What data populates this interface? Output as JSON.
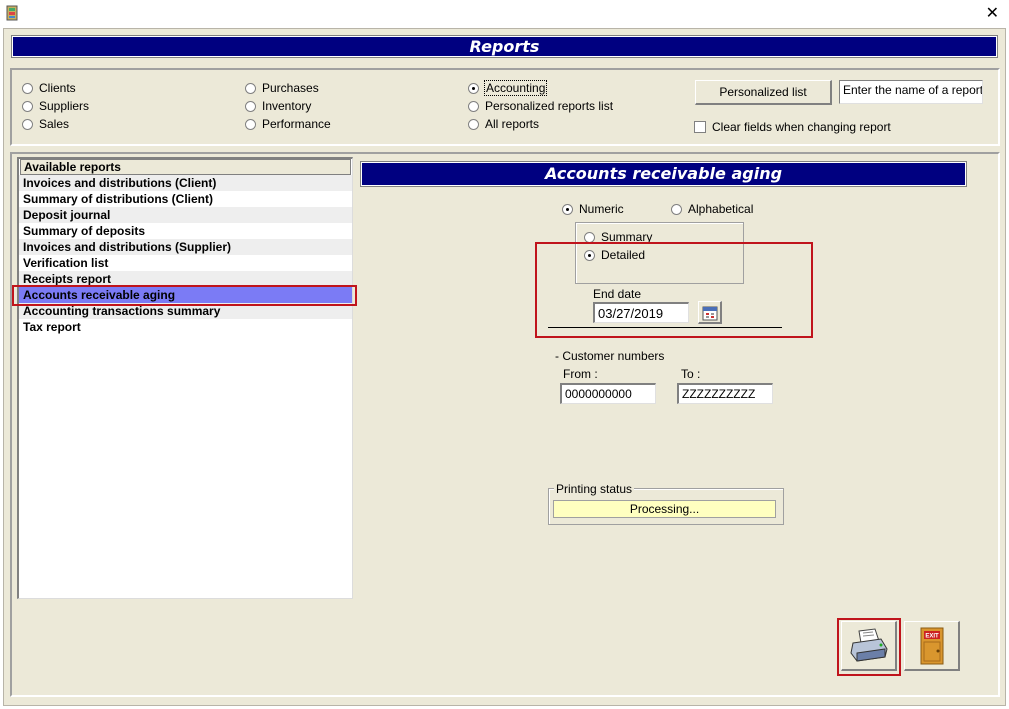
{
  "window": {
    "close_glyph": "✕"
  },
  "header": {
    "title": "Reports"
  },
  "categories": {
    "clients": "Clients",
    "suppliers": "Suppliers",
    "sales": "Sales",
    "purchases": "Purchases",
    "inventory": "Inventory",
    "performance": "Performance",
    "accounting": "Accounting",
    "personalized_reports_list": "Personalized reports list",
    "all_reports": "All reports",
    "selected": "accounting"
  },
  "top_controls": {
    "personalized_list_button": "Personalized list",
    "report_name_value": "Enter the name of a report",
    "clear_fields_label": "Clear fields when changing report",
    "clear_fields_checked": false
  },
  "reports_list": {
    "header": "Available reports",
    "items": [
      "Invoices and distributions (Client)",
      "Summary of distributions (Client)",
      "Deposit journal",
      "Summary of deposits",
      "Invoices and distributions (Supplier)",
      "Verification list",
      "Receipts report",
      "Accounts receivable aging",
      "Accounting transactions summary",
      "Tax report"
    ],
    "selected_index": 7
  },
  "report_panel": {
    "title": "Accounts receivable aging",
    "sort": {
      "numeric": "Numeric",
      "alphabetical": "Alphabetical",
      "selected": "numeric"
    },
    "detail": {
      "summary": "Summary",
      "detailed": "Detailed",
      "selected": "detailed"
    },
    "end_date_label": "End date",
    "end_date_value": "03/27/2019",
    "customer_numbers_label": "- Customer numbers",
    "from_label": "From :",
    "from_value": "0000000000",
    "to_label": "To :",
    "to_value": "ZZZZZZZZZZ",
    "printing_status_label": "Printing status",
    "printing_status_value": "Processing..."
  },
  "icons": {
    "print": "printer-icon",
    "exit": "exit-door-icon",
    "calendar": "calendar-icon"
  },
  "exit_sign_text": "EXIT",
  "colors": {
    "header_blue": "#000080",
    "selected_row": "#7b7bf5",
    "status_yellow": "#ffffc0",
    "highlight_red": "#c0141c"
  }
}
